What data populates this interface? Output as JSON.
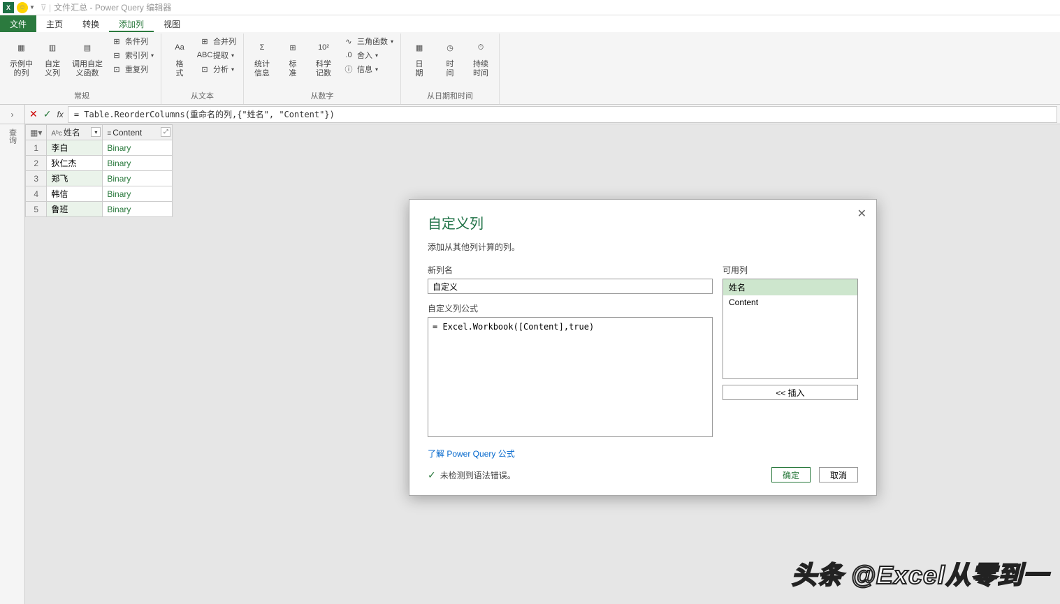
{
  "title": {
    "doc": "文件汇总",
    "app": "Power Query 编辑器"
  },
  "tabs": {
    "file": "文件",
    "home": "主页",
    "transform": "转换",
    "addcol": "添加列",
    "view": "视图"
  },
  "ribbon": {
    "general": {
      "label": "常规",
      "examples": "示例中\n的列",
      "custom": "自定\n义列",
      "invoke": "调用自定\n义函数",
      "cond": "条件列",
      "index": "索引列",
      "dup": "重复列"
    },
    "text": {
      "label": "从文本",
      "format": "格\n式",
      "merge": "合并列",
      "extract": "提取",
      "parse": "分析"
    },
    "number": {
      "label": "从数字",
      "stats": "统计\n信息",
      "standard": "标\n准",
      "sci": "科学\n记数",
      "trig": "三角函数",
      "round": "舍入",
      "info": "信息"
    },
    "datetime": {
      "label": "从日期和时间",
      "date": "日\n期",
      "time": "时\n间",
      "duration": "持续\n时间"
    }
  },
  "fx": {
    "formula": "= Table.ReorderColumns(重命名的列,{\"姓名\", \"Content\"})"
  },
  "grid": {
    "col1": "姓名",
    "col2": "Content",
    "rows": [
      {
        "n": "1",
        "name": "李白",
        "content": "Binary"
      },
      {
        "n": "2",
        "name": "狄仁杰",
        "content": "Binary"
      },
      {
        "n": "3",
        "name": "郑飞",
        "content": "Binary"
      },
      {
        "n": "4",
        "name": "韩信",
        "content": "Binary"
      },
      {
        "n": "5",
        "name": "鲁班",
        "content": "Binary"
      }
    ]
  },
  "dialog": {
    "title": "自定义列",
    "subtitle": "添加从其他列计算的列。",
    "newcol_label": "新列名",
    "newcol_value": "自定义",
    "formula_label": "自定义列公式",
    "formula_value": "= Excel.Workbook([Content],true)",
    "avail_label": "可用列",
    "avail_items": [
      "姓名",
      "Content"
    ],
    "insert": "<< 插入",
    "link": "了解 Power Query 公式",
    "status": "未检测到语法错误。",
    "ok": "确定",
    "cancel": "取消"
  },
  "watermark": "头条 @Excel从零到一"
}
